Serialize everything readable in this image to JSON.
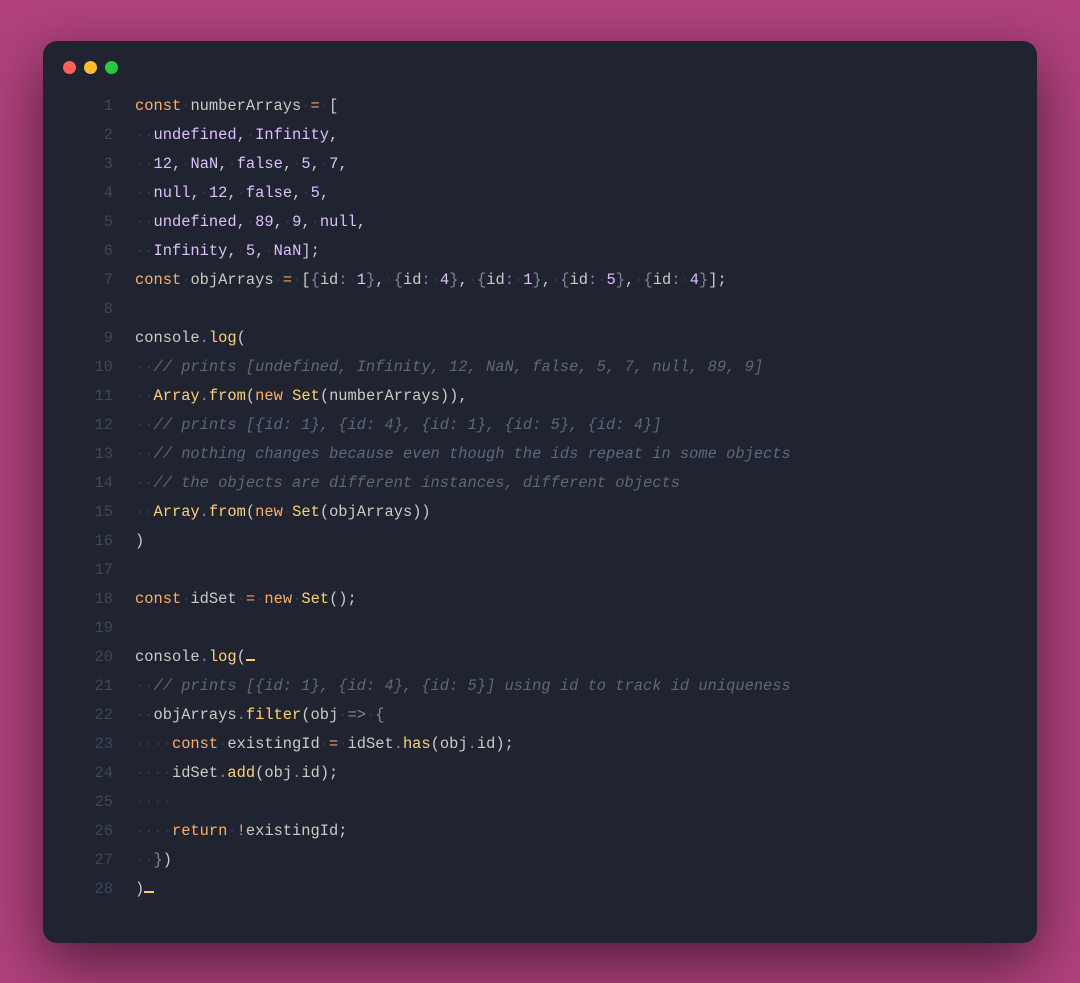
{
  "window": {
    "traffic_lights": [
      "red",
      "yellow",
      "green"
    ]
  },
  "lines": [
    {
      "n": 1,
      "tokens": [
        [
          "kw",
          "const"
        ],
        [
          "ws",
          "·"
        ],
        [
          "var",
          "numberArrays"
        ],
        [
          "ws",
          "·"
        ],
        [
          "op",
          "="
        ],
        [
          "ws",
          "·"
        ],
        [
          "pun",
          "["
        ]
      ]
    },
    {
      "n": 2,
      "tokens": [
        [
          "ws",
          "··"
        ],
        [
          "cst",
          "undefined"
        ],
        [
          "pun",
          ","
        ],
        [
          "ws",
          "·"
        ],
        [
          "cst",
          "Infinity"
        ],
        [
          "pun",
          ","
        ]
      ]
    },
    {
      "n": 3,
      "tokens": [
        [
          "ws",
          "··"
        ],
        [
          "num",
          "12"
        ],
        [
          "pun",
          ","
        ],
        [
          "ws",
          "·"
        ],
        [
          "cst",
          "NaN"
        ],
        [
          "pun",
          ","
        ],
        [
          "ws",
          "·"
        ],
        [
          "cst",
          "false"
        ],
        [
          "pun",
          ","
        ],
        [
          "ws",
          "·"
        ],
        [
          "num",
          "5"
        ],
        [
          "pun",
          ","
        ],
        [
          "ws",
          "·"
        ],
        [
          "num",
          "7"
        ],
        [
          "pun",
          ","
        ]
      ]
    },
    {
      "n": 4,
      "tokens": [
        [
          "ws",
          "··"
        ],
        [
          "cst",
          "null"
        ],
        [
          "pun",
          ","
        ],
        [
          "ws",
          "·"
        ],
        [
          "num",
          "12"
        ],
        [
          "pun",
          ","
        ],
        [
          "ws",
          "·"
        ],
        [
          "cst",
          "false"
        ],
        [
          "pun",
          ","
        ],
        [
          "ws",
          "·"
        ],
        [
          "num",
          "5"
        ],
        [
          "pun",
          ","
        ]
      ]
    },
    {
      "n": 5,
      "tokens": [
        [
          "ws",
          "··"
        ],
        [
          "cst",
          "undefined"
        ],
        [
          "pun",
          ","
        ],
        [
          "ws",
          "·"
        ],
        [
          "num",
          "89"
        ],
        [
          "pun",
          ","
        ],
        [
          "ws",
          "·"
        ],
        [
          "num",
          "9"
        ],
        [
          "pun",
          ","
        ],
        [
          "ws",
          "·"
        ],
        [
          "cst",
          "null"
        ],
        [
          "pun",
          ","
        ]
      ]
    },
    {
      "n": 6,
      "tokens": [
        [
          "ws",
          "··"
        ],
        [
          "cst",
          "Infinity"
        ],
        [
          "pun",
          ","
        ],
        [
          "ws",
          "·"
        ],
        [
          "num",
          "5"
        ],
        [
          "pun",
          ","
        ],
        [
          "ws",
          "·"
        ],
        [
          "cst",
          "NaN"
        ],
        [
          "pun",
          "];"
        ]
      ]
    },
    {
      "n": 7,
      "tokens": [
        [
          "kw",
          "const"
        ],
        [
          "ws",
          "·"
        ],
        [
          "var",
          "objArrays"
        ],
        [
          "ws",
          "·"
        ],
        [
          "op",
          "="
        ],
        [
          "ws",
          "·"
        ],
        [
          "pun",
          "["
        ],
        [
          "p2",
          "{"
        ],
        [
          "var",
          "id"
        ],
        [
          "p2",
          ":"
        ],
        [
          "ws",
          "·"
        ],
        [
          "num",
          "1"
        ],
        [
          "p2",
          "}"
        ],
        [
          "pun",
          ","
        ],
        [
          "ws",
          "·"
        ],
        [
          "p2",
          "{"
        ],
        [
          "var",
          "id"
        ],
        [
          "p2",
          ":"
        ],
        [
          "ws",
          "·"
        ],
        [
          "num",
          "4"
        ],
        [
          "p2",
          "}"
        ],
        [
          "pun",
          ","
        ],
        [
          "ws",
          "·"
        ],
        [
          "p2",
          "{"
        ],
        [
          "var",
          "id"
        ],
        [
          "p2",
          ":"
        ],
        [
          "ws",
          "·"
        ],
        [
          "num",
          "1"
        ],
        [
          "p2",
          "}"
        ],
        [
          "pun",
          ","
        ],
        [
          "ws",
          "·"
        ],
        [
          "p2",
          "{"
        ],
        [
          "var",
          "id"
        ],
        [
          "p2",
          ":"
        ],
        [
          "ws",
          "·"
        ],
        [
          "num",
          "5"
        ],
        [
          "p2",
          "}"
        ],
        [
          "pun",
          ","
        ],
        [
          "ws",
          "·"
        ],
        [
          "p2",
          "{"
        ],
        [
          "var",
          "id"
        ],
        [
          "p2",
          ":"
        ],
        [
          "ws",
          "·"
        ],
        [
          "num",
          "4"
        ],
        [
          "p2",
          "}"
        ],
        [
          "pun",
          "];"
        ]
      ]
    },
    {
      "n": 8,
      "tokens": []
    },
    {
      "n": 9,
      "tokens": [
        [
          "var",
          "console"
        ],
        [
          "p2",
          "."
        ],
        [
          "fn",
          "log"
        ],
        [
          "pun",
          "("
        ]
      ]
    },
    {
      "n": 10,
      "tokens": [
        [
          "ws",
          "··"
        ],
        [
          "com",
          "// prints [undefined, Infinity, 12, NaN, false, 5, 7, null, 89, 9]"
        ]
      ]
    },
    {
      "n": 11,
      "tokens": [
        [
          "ws",
          "··"
        ],
        [
          "fn",
          "Array"
        ],
        [
          "p2",
          "."
        ],
        [
          "fn",
          "from"
        ],
        [
          "pun",
          "("
        ],
        [
          "kw",
          "new"
        ],
        [
          "ws",
          "·"
        ],
        [
          "fn",
          "Set"
        ],
        [
          "pun",
          "("
        ],
        [
          "var",
          "numberArrays"
        ],
        [
          "pun",
          "))"
        ],
        [
          "pun",
          ","
        ]
      ]
    },
    {
      "n": 12,
      "tokens": [
        [
          "ws",
          "··"
        ],
        [
          "com",
          "// prints [{id: 1}, {id: 4}, {id: 1}, {id: 5}, {id: 4}]"
        ]
      ]
    },
    {
      "n": 13,
      "tokens": [
        [
          "ws",
          "··"
        ],
        [
          "com",
          "// nothing changes because even though the ids repeat in some objects"
        ]
      ]
    },
    {
      "n": 14,
      "tokens": [
        [
          "ws",
          "··"
        ],
        [
          "com",
          "// the objects are different instances, different objects"
        ]
      ]
    },
    {
      "n": 15,
      "tokens": [
        [
          "ws",
          "··"
        ],
        [
          "fn",
          "Array"
        ],
        [
          "p2",
          "."
        ],
        [
          "fn",
          "from"
        ],
        [
          "pun",
          "("
        ],
        [
          "kw",
          "new"
        ],
        [
          "ws",
          "·"
        ],
        [
          "fn",
          "Set"
        ],
        [
          "pun",
          "("
        ],
        [
          "var",
          "objArrays"
        ],
        [
          "pun",
          "))"
        ]
      ]
    },
    {
      "n": 16,
      "tokens": [
        [
          "pun",
          ")"
        ]
      ]
    },
    {
      "n": 17,
      "tokens": []
    },
    {
      "n": 18,
      "tokens": [
        [
          "kw",
          "const"
        ],
        [
          "ws",
          "·"
        ],
        [
          "var",
          "idSet"
        ],
        [
          "ws",
          "·"
        ],
        [
          "op",
          "="
        ],
        [
          "ws",
          "·"
        ],
        [
          "kw",
          "new"
        ],
        [
          "ws",
          "·"
        ],
        [
          "fn",
          "Set"
        ],
        [
          "pun",
          "();"
        ]
      ]
    },
    {
      "n": 19,
      "tokens": []
    },
    {
      "n": 20,
      "tokens": [
        [
          "var",
          "console"
        ],
        [
          "p2",
          "."
        ],
        [
          "fn",
          "log"
        ],
        [
          "pun",
          "("
        ],
        [
          "cursor",
          ""
        ]
      ]
    },
    {
      "n": 21,
      "tokens": [
        [
          "ws",
          "··"
        ],
        [
          "com",
          "// prints [{id: 1}, {id: 4}, {id: 5}] using id to track id uniqueness"
        ]
      ]
    },
    {
      "n": 22,
      "tokens": [
        [
          "ws",
          "··"
        ],
        [
          "var",
          "objArrays"
        ],
        [
          "p2",
          "."
        ],
        [
          "fn",
          "filter"
        ],
        [
          "pun",
          "("
        ],
        [
          "var",
          "obj"
        ],
        [
          "ws",
          "·"
        ],
        [
          "p2",
          "=>"
        ],
        [
          "ws",
          "·"
        ],
        [
          "p2",
          "{"
        ]
      ]
    },
    {
      "n": 23,
      "tokens": [
        [
          "ws",
          "····"
        ],
        [
          "kw",
          "const"
        ],
        [
          "ws",
          "·"
        ],
        [
          "var",
          "existingId"
        ],
        [
          "ws",
          "·"
        ],
        [
          "op",
          "="
        ],
        [
          "ws",
          "·"
        ],
        [
          "var",
          "idSet"
        ],
        [
          "p2",
          "."
        ],
        [
          "fn",
          "has"
        ],
        [
          "pun",
          "("
        ],
        [
          "var",
          "obj"
        ],
        [
          "p2",
          "."
        ],
        [
          "var",
          "id"
        ],
        [
          "pun",
          ");"
        ]
      ]
    },
    {
      "n": 24,
      "tokens": [
        [
          "ws",
          "····"
        ],
        [
          "var",
          "idSet"
        ],
        [
          "p2",
          "."
        ],
        [
          "fn",
          "add"
        ],
        [
          "pun",
          "("
        ],
        [
          "var",
          "obj"
        ],
        [
          "p2",
          "."
        ],
        [
          "var",
          "id"
        ],
        [
          "pun",
          ");"
        ]
      ]
    },
    {
      "n": 25,
      "tokens": [
        [
          "ws",
          "····"
        ]
      ]
    },
    {
      "n": 26,
      "tokens": [
        [
          "ws",
          "····"
        ],
        [
          "kw",
          "return"
        ],
        [
          "ws",
          "·"
        ],
        [
          "op",
          "!"
        ],
        [
          "var",
          "existingId"
        ],
        [
          "pun",
          ";"
        ]
      ]
    },
    {
      "n": 27,
      "tokens": [
        [
          "ws",
          "··"
        ],
        [
          "p2",
          "}"
        ],
        [
          "pun",
          ")"
        ]
      ]
    },
    {
      "n": 28,
      "tokens": [
        [
          "pun",
          ")"
        ],
        [
          "cursor",
          ""
        ]
      ]
    }
  ]
}
